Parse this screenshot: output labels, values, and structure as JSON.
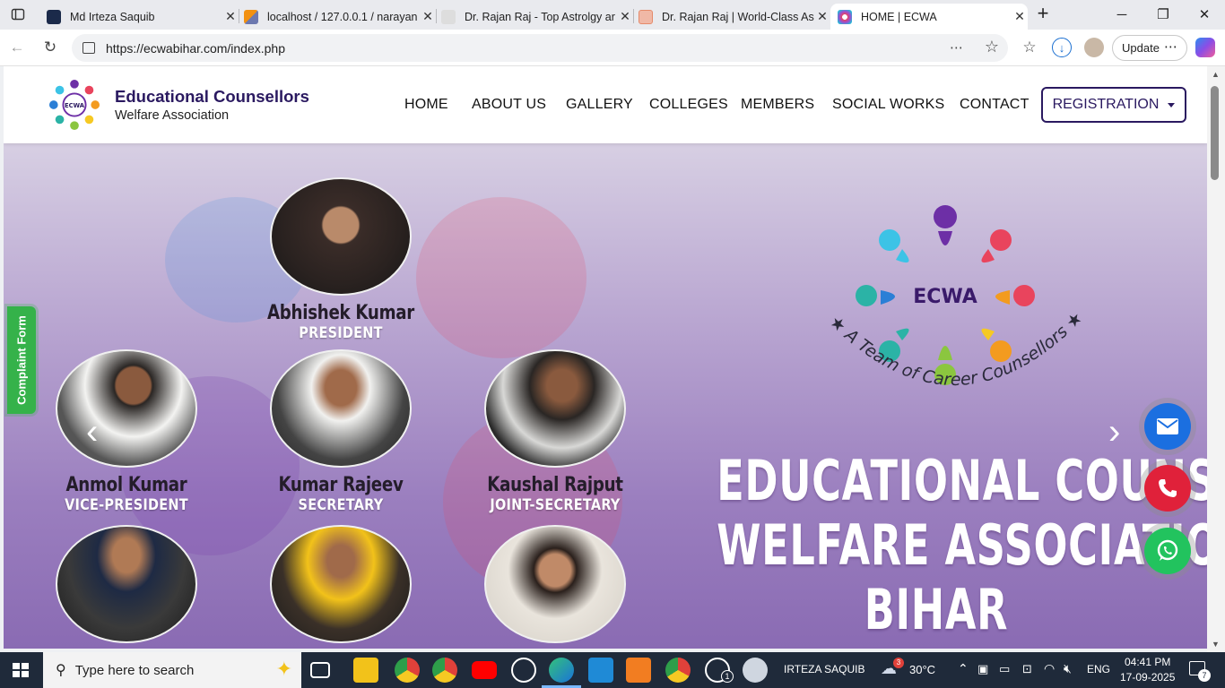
{
  "browser": {
    "tabs": [
      {
        "title": "Md Irteza Saquib",
        "favicon_color": "#1b2a4a"
      },
      {
        "title": "localhost / 127.0.0.1 / narayan",
        "favicon_color": "#f29111"
      },
      {
        "title": "Dr. Rajan Raj - Top Astrolgy ar",
        "favicon_color": "#cccccc"
      },
      {
        "title": "Dr. Rajan Raj | World-Class Ast",
        "favicon_color": "#e58a6a"
      },
      {
        "title": "HOME | ECWA",
        "favicon_color": "#9a4fd1",
        "active": true
      }
    ],
    "url": "https://ecwabihar.com/index.php",
    "update_label": "Update"
  },
  "site": {
    "brand_line1": "Educational Counsellors",
    "brand_line2": "Welfare Association",
    "logo_text": "ECWA",
    "nav": [
      "HOME",
      "ABOUT US",
      "GALLERY",
      "COLLEGES",
      "MEMBERS",
      "SOCIAL WORKS",
      "CONTACT"
    ],
    "registration_label": "REGISTRATION",
    "complaint_label": "Complaint Form"
  },
  "hero": {
    "members": [
      {
        "name": "Abhishek Kumar",
        "role": "PRESIDENT"
      },
      {
        "name": "Anmol Kumar",
        "role": "VICE-PRESIDENT"
      },
      {
        "name": "Kumar Rajeev",
        "role": "SECRETARY"
      },
      {
        "name": "Kaushal Rajput",
        "role": "JOINT-SECRETARY"
      },
      {
        "name": "",
        "role": ""
      },
      {
        "name": "",
        "role": ""
      },
      {
        "name": "",
        "role": ""
      }
    ],
    "emblem_text": "ECWA",
    "tagline": "★ A Team of Career Counsellors ★",
    "title_line1": "EDUCATIONAL COUNSELLORS",
    "title_line2": "WELFARE ASSOCIATION",
    "title_line3": "BIHAR",
    "colors": {
      "email": "#1b6fe0",
      "phone": "#e0213a",
      "whatsapp": "#22c35e"
    }
  },
  "taskbar": {
    "search_placeholder": "Type here to search",
    "user": "IRTEZA SAQUIB",
    "temperature": "30°C",
    "weather_badge": "3",
    "whatsapp_badge": "1",
    "language": "ENG",
    "time": "04:41 PM",
    "date": "17-09-2025",
    "notifications": "7"
  }
}
